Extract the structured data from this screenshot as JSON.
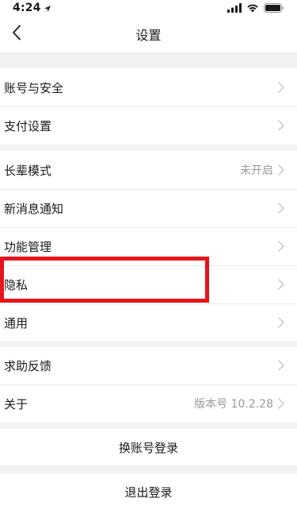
{
  "status_bar": {
    "time": "4:24",
    "icons": [
      "location-arrow-icon",
      "signal-icon",
      "wifi-icon",
      "battery-icon"
    ]
  },
  "nav": {
    "title": "设置",
    "back_icon": "chevron-left-icon"
  },
  "groups": [
    {
      "rows": [
        {
          "label": "账号与安全",
          "value": ""
        },
        {
          "label": "支付设置",
          "value": ""
        }
      ]
    },
    {
      "rows": [
        {
          "label": "长辈模式",
          "value": "未开启"
        },
        {
          "label": "新消息通知",
          "value": ""
        },
        {
          "label": "功能管理",
          "value": ""
        },
        {
          "label": "隐私",
          "value": ""
        },
        {
          "label": "通用",
          "value": ""
        }
      ]
    },
    {
      "rows": [
        {
          "label": "求助反馈",
          "value": ""
        },
        {
          "label": "关于",
          "value": "版本号 10.2.28"
        }
      ]
    }
  ],
  "actions": {
    "switch_account": "换账号登录",
    "logout": "退出登录"
  },
  "colors": {
    "background": "#f2f2f2",
    "surface": "#ffffff",
    "secondary_text": "#9a9a9a",
    "highlight": "#e8141c"
  }
}
